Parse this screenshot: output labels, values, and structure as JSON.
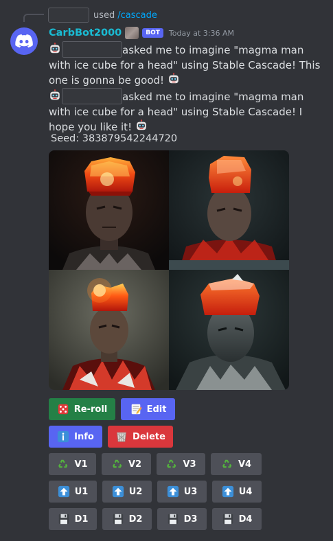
{
  "reply": {
    "used_text": "used",
    "command": "/cascade"
  },
  "author": {
    "name": "CarbBot2000",
    "bot_tag": "BOT",
    "timestamp": "Today at 3:36 AM"
  },
  "messages": [
    {
      "text": "asked me to imagine \"magma man with ice cube for a head\" using Stable Cascade! This one is gonna be good!"
    },
    {
      "text": "asked me to imagine \"magma man with ice cube for a head\" using Stable Cascade! I hope you like it!"
    }
  ],
  "seed": "Seed: 383879542244720",
  "buttons": {
    "reroll": "Re-roll",
    "edit": "Edit",
    "info": "Info",
    "delete": "Delete",
    "variations": [
      "V1",
      "V2",
      "V3",
      "V4"
    ],
    "upscales": [
      "U1",
      "U2",
      "U3",
      "U4"
    ],
    "downloads": [
      "D1",
      "D2",
      "D3",
      "D4"
    ]
  },
  "icons": {
    "avatar": "discord-logo-icon",
    "robot": "robot-face-icon",
    "reroll": "game-die-icon",
    "edit": "memo-icon",
    "info": "information-icon",
    "delete": "wastebasket-icon",
    "variation": "recycle-icon",
    "upscale": "up-arrow-icon",
    "download": "floppy-disk-icon"
  },
  "colors": {
    "background": "#313338",
    "username": "#1abcd4",
    "command_link": "#00a8fc",
    "bot_tag": "#5865f2",
    "success_button": "#248046",
    "primary_button": "#5865f2",
    "danger_button": "#da373c",
    "secondary_button": "#4e5058"
  }
}
